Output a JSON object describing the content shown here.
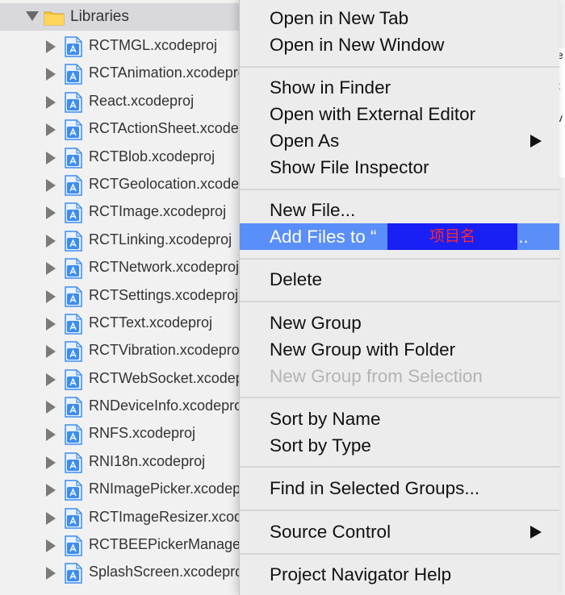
{
  "navigator": {
    "group_label": "Libraries",
    "items": [
      {
        "label": "RCTMGL.xcodeproj"
      },
      {
        "label": "RCTAnimation.xcodeproj"
      },
      {
        "label": "React.xcodeproj"
      },
      {
        "label": "RCTActionSheet.xcodeproj"
      },
      {
        "label": "RCTBlob.xcodeproj"
      },
      {
        "label": "RCTGeolocation.xcodeproj"
      },
      {
        "label": "RCTImage.xcodeproj"
      },
      {
        "label": "RCTLinking.xcodeproj"
      },
      {
        "label": "RCTNetwork.xcodeproj"
      },
      {
        "label": "RCTSettings.xcodeproj"
      },
      {
        "label": "RCTText.xcodeproj"
      },
      {
        "label": "RCTVibration.xcodeproj"
      },
      {
        "label": "RCTWebSocket.xcodeproj"
      },
      {
        "label": "RNDeviceInfo.xcodeproj"
      },
      {
        "label": "RNFS.xcodeproj"
      },
      {
        "label": "RNI18n.xcodeproj"
      },
      {
        "label": "RNImagePicker.xcodeproj"
      },
      {
        "label": "RCTImageResizer.xcodeproj"
      },
      {
        "label": "RCTBEEPickerManager.xcodeproj"
      },
      {
        "label": "SplashScreen.xcodeproj"
      }
    ]
  },
  "context_menu": {
    "open_in_new_tab": "Open in New Tab",
    "open_in_new_window": "Open in New Window",
    "show_in_finder": "Show in Finder",
    "open_with_external_editor": "Open with External Editor",
    "open_as": "Open As",
    "show_file_inspector": "Show File Inspector",
    "new_file": "New File...",
    "add_files_prefix": "Add Files to “",
    "add_files_suffix": "”...",
    "project_name": "项目名",
    "delete": "Delete",
    "new_group": "New Group",
    "new_group_with_folder": "New Group with Folder",
    "new_group_from_selection": "New Group from Selection",
    "sort_by_name": "Sort by Name",
    "sort_by_type": "Sort by Type",
    "find_in_selected_groups": "Find in Selected Groups...",
    "source_control": "Source Control",
    "project_navigator_help": "Project Navigator Help"
  },
  "right_edge_glyphs": [
    "e",
    "t",
    "v"
  ],
  "colors": {
    "menu_highlight": "#5a8ef8",
    "redaction_box": "#1a1ff5",
    "redaction_text": "#ff2828",
    "folder_yellow": "#f5c542",
    "file_icon_blue": "#3d8df0"
  },
  "icons": {
    "group": "folder-icon",
    "file": "xcodeproj-file-icon",
    "expanded": "disclosure-triangle-down-icon",
    "collapsed": "disclosure-triangle-right-icon",
    "submenu": "submenu-arrow-icon"
  }
}
